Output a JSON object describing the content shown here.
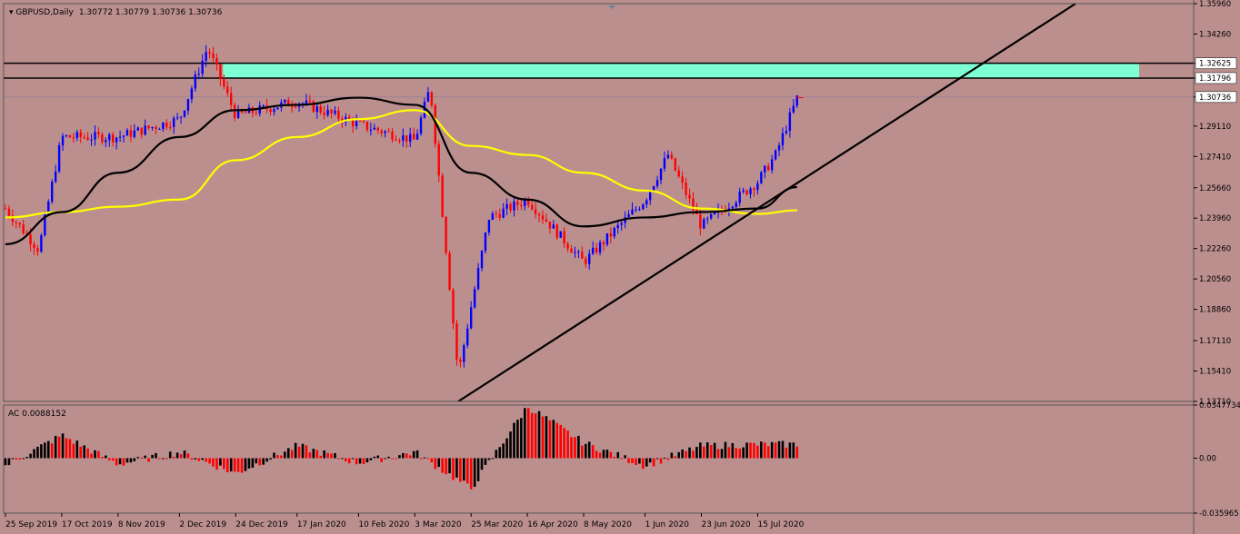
{
  "header": {
    "symbol": "GBPUSD,Daily",
    "ohlc": "1.30772 1.30779 1.30736 1.30736"
  },
  "price_axis": {
    "ticks": [
      "1.35960",
      "1.34260",
      "1.32625",
      "1.31796",
      "1.30736",
      "1.29110",
      "1.27410",
      "1.25660",
      "1.23960",
      "1.22260",
      "1.20560",
      "1.18860",
      "1.17110",
      "1.15410",
      "1.13710"
    ],
    "highlighted": [
      "1.32625",
      "1.31796",
      "1.30736"
    ]
  },
  "time_axis": {
    "labels": [
      "25 Sep 2019",
      "17 Oct 2019",
      "8 Nov 2019",
      "2 Dec 2019",
      "24 Dec 2019",
      "17 Jan 2020",
      "10 Feb 2020",
      "3 Mar 2020",
      "25 Mar 2020",
      "16 Apr 2020",
      "8 May 2020",
      "1 Jun 2020",
      "23 Jun 2020",
      "15 Jul 2020"
    ]
  },
  "indicator": {
    "label": "AC 0.0088152",
    "ticks": [
      "0.0347734",
      "0.00",
      "-0.035965"
    ]
  },
  "colors": {
    "background": "#bc8f8f",
    "bull": "#0000ff",
    "bear": "#ff0000",
    "zone": "#7fffd4",
    "ma_fast": "#000000",
    "ma_slow": "#ffff00",
    "ac_up": "#000000",
    "ac_down": "#ff0000"
  },
  "chart_data": [
    {
      "type": "candlestick",
      "symbol": "GBPUSD",
      "timeframe": "Daily",
      "ylim": [
        1.1371,
        1.3596
      ],
      "key_points": [
        {
          "date": "25 Sep 2019",
          "close": 1.245
        },
        {
          "date": "8 Oct 2019",
          "close": 1.222
        },
        {
          "date": "17 Oct 2019",
          "close": 1.285
        },
        {
          "date": "8 Nov 2019",
          "close": 1.285
        },
        {
          "date": "2 Dec 2019",
          "close": 1.295
        },
        {
          "date": "13 Dec 2019",
          "close": 1.335
        },
        {
          "date": "24 Dec 2019",
          "close": 1.297
        },
        {
          "date": "17 Jan 2020",
          "close": 1.305
        },
        {
          "date": "10 Feb 2020",
          "close": 1.292
        },
        {
          "date": "3 Mar 2020",
          "close": 1.283
        },
        {
          "date": "9 Mar 2020",
          "close": 1.313
        },
        {
          "date": "20 Mar 2020",
          "close": 1.152
        },
        {
          "date": "25 Mar 2020",
          "close": 1.19
        },
        {
          "date": "1 Apr 2020",
          "close": 1.24
        },
        {
          "date": "16 Apr 2020",
          "close": 1.25
        },
        {
          "date": "8 May 2020",
          "close": 1.215
        },
        {
          "date": "1 Jun 2020",
          "close": 1.25
        },
        {
          "date": "10 Jun 2020",
          "close": 1.275
        },
        {
          "date": "23 Jun 2020",
          "close": 1.235
        },
        {
          "date": "15 Jul 2020",
          "close": 1.26
        },
        {
          "date": "22 Jul 2020",
          "close": 1.275
        },
        {
          "date": "31 Jul 2020",
          "close": 1.309
        }
      ],
      "resistance_zone": [
        1.31796,
        1.32625
      ],
      "current_price": 1.30736,
      "trendline": [
        {
          "date": "20 Mar 2020",
          "price": 1.1371
        },
        {
          "date": "15 Jul 2020",
          "price": 1.245
        }
      ],
      "moving_averages": [
        {
          "color": "black",
          "values_at_labels": [
            1.225,
            1.243,
            1.265,
            1.285,
            1.3,
            1.303,
            1.307,
            1.303,
            1.265,
            1.25,
            1.235,
            1.24,
            1.243,
            1.245
          ]
        },
        {
          "color": "yellow",
          "values_at_labels": [
            1.24,
            1.243,
            1.246,
            1.25,
            1.272,
            1.285,
            1.295,
            1.3,
            1.28,
            1.275,
            1.265,
            1.255,
            1.245,
            1.242
          ]
        }
      ]
    },
    {
      "type": "bar",
      "name": "AC",
      "last_value": 0.0088152,
      "ylim": [
        -0.035965,
        0.0347734
      ],
      "values_at_labels": [
        -0.005,
        0.015,
        -0.004,
        0.004,
        -0.01,
        0.008,
        -0.003,
        0.004,
        -0.02,
        0.034,
        0.01,
        -0.005,
        0.008,
        0.009
      ]
    }
  ]
}
